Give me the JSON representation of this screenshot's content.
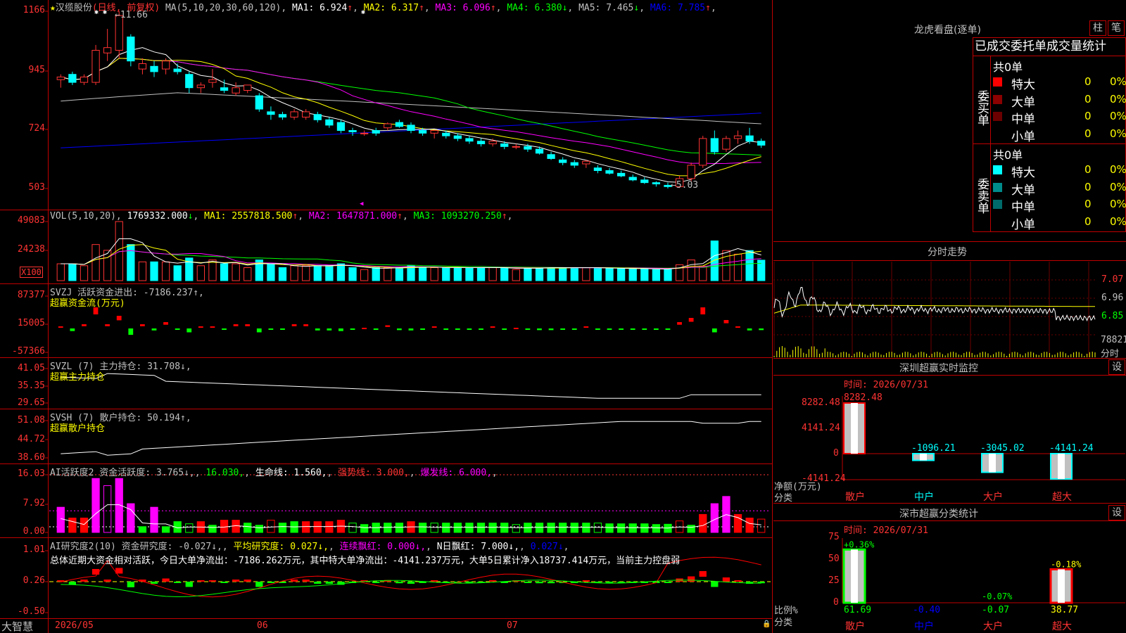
{
  "stock": {
    "name": "汉缆股份",
    "period": "(日线, 前复权)",
    "ma_readout": [
      {
        "label": "MA(5,10,20,30,60,120)",
        "color": "#c0c0c0"
      },
      {
        "label": "MA1: 6.924",
        "arrow": "↑",
        "color": "#ffffff"
      },
      {
        "label": "MA2: 6.317",
        "arrow": "↑",
        "color": "#ffff00"
      },
      {
        "label": "MA3: 6.096",
        "arrow": "↑",
        "color": "#ff00ff"
      },
      {
        "label": "MA4: 6.380",
        "arrow": "↓",
        "color": "#00ff00"
      },
      {
        "label": "MA5: 7.465",
        "arrow": "↓",
        "color": "#c0c0c0"
      },
      {
        "label": "MA6: 7.785",
        "arrow": "↑",
        "color": "#0000ff"
      }
    ],
    "high_label": "11.66",
    "low_label": "5.03"
  },
  "price_axis": [
    "1166",
    "945",
    "724",
    "503"
  ],
  "vol_readout": [
    {
      "label": "VOL(5,10,20)",
      "color": "#c0c0c0"
    },
    {
      "label": "1769332.000",
      "arrow": "↓",
      "color": "#ffffff"
    },
    {
      "label": "MA1: 2557818.500",
      "arrow": "↑",
      "color": "#ffff00"
    },
    {
      "label": "MA2: 1647871.000",
      "arrow": "↑",
      "color": "#ff00ff"
    },
    {
      "label": "MA3: 1093270.250",
      "arrow": "↑",
      "color": "#00ff00"
    }
  ],
  "vol_axis": [
    "49083",
    "24238"
  ],
  "vol_unit": "X100",
  "svzj": {
    "readout": "SVZJ  活跃资金进出: -7186.237↑,",
    "sub": "超赢资金流(万元)",
    "axis": [
      "87377",
      "15005",
      "-57366"
    ]
  },
  "svzl": {
    "readout": "SVZL (7) 主力持仓: 31.708↓,",
    "sub": "超赢主力持仓",
    "axis": [
      "41.05",
      "35.35",
      "29.65"
    ]
  },
  "svsh": {
    "readout": "SVSH (7) 散户持仓: 50.194↑,",
    "sub": "超赢散户持仓",
    "axis": [
      "51.08",
      "44.72",
      "38.60"
    ]
  },
  "ai1": {
    "readout": [
      {
        "label": "AI活跃度2 资金活跃度: 3.765↓,",
        "color": "#c0c0c0"
      },
      {
        "label": "16.030,",
        "color": "#00ff00"
      },
      {
        "label": "生命线: 1.560,",
        "color": "#ffffff"
      },
      {
        "label": "强势线: 3.000,",
        "color": "#ff3333"
      },
      {
        "label": "爆发线: 6.000,",
        "color": "#ff00ff"
      }
    ],
    "axis": [
      "16.03",
      "7.92",
      "0.00"
    ]
  },
  "ai2": {
    "readout": [
      {
        "label": "AI研究度2(10) 资金研究度: -0.027↓,",
        "color": "#c0c0c0"
      },
      {
        "label": "平均研究度: 0.027↓,",
        "color": "#ffff00"
      },
      {
        "label": "连续飘红: 0.000↓,",
        "color": "#ff00ff"
      },
      {
        "label": "N日飘红: 7.000↓,",
        "color": "#ffffff"
      },
      {
        "label": "0.027↓",
        "color": "#0000ff"
      }
    ],
    "summary": "总体近期大资金相对活跃，今日大单净流出：-7186.262万元，其中特大单净流出：-4141.237万元，大单5日累计净入18737.414万元，当前主力控盘弱",
    "axis": [
      "1.01",
      "0.26",
      "-0.50"
    ]
  },
  "time_axis": {
    "brand": "大智慧",
    "labels": [
      "2026/05",
      "06",
      "07"
    ]
  },
  "chart_data": [
    {
      "type": "candlestick",
      "title": "汉缆股份 (日线, 前复权)",
      "ylim": [
        5.03,
        11.66
      ],
      "series": [
        {
          "name": "K",
          "ohlc": [
            [
              9.1,
              9.3,
              8.8,
              9.2
            ],
            [
              9.3,
              9.4,
              8.9,
              9.0
            ],
            [
              9.0,
              9.3,
              8.9,
              9.2
            ],
            [
              9.0,
              10.4,
              8.9,
              10.2
            ],
            [
              10.1,
              11.0,
              9.8,
              10.3
            ],
            [
              10.2,
              11.66,
              9.9,
              11.5
            ],
            [
              10.7,
              10.8,
              9.6,
              9.8
            ],
            [
              9.5,
              9.9,
              9.3,
              9.7
            ],
            [
              9.6,
              9.8,
              9.2,
              9.4
            ],
            [
              9.5,
              9.9,
              9.3,
              9.8
            ],
            [
              9.5,
              9.7,
              9.3,
              9.4
            ],
            [
              9.3,
              9.4,
              8.6,
              8.8
            ],
            [
              8.8,
              9.0,
              8.6,
              8.9
            ],
            [
              9.0,
              9.5,
              8.8,
              9.1
            ],
            [
              8.8,
              9.1,
              8.6,
              8.7
            ],
            [
              8.6,
              9.0,
              8.5,
              8.8
            ],
            [
              8.7,
              8.9,
              8.6,
              8.9
            ],
            [
              8.5,
              8.6,
              7.9,
              8.0
            ],
            [
              7.9,
              8.1,
              7.6,
              7.8
            ],
            [
              7.8,
              7.9,
              7.6,
              7.7
            ],
            [
              7.7,
              8.0,
              7.6,
              7.9
            ],
            [
              7.7,
              8.0,
              7.6,
              7.9
            ],
            [
              7.8,
              7.9,
              7.5,
              7.6
            ],
            [
              7.6,
              7.7,
              7.3,
              7.4
            ],
            [
              7.5,
              7.6,
              7.1,
              7.2
            ],
            [
              7.2,
              7.3,
              7.0,
              7.15
            ],
            [
              7.1,
              7.2,
              7.0,
              7.1
            ],
            [
              7.2,
              7.3,
              7.0,
              7.1
            ],
            [
              7.3,
              7.5,
              7.2,
              7.45
            ],
            [
              7.5,
              7.6,
              7.3,
              7.35
            ],
            [
              7.4,
              7.5,
              7.1,
              7.2
            ],
            [
              7.2,
              7.3,
              7.0,
              7.1
            ],
            [
              7.1,
              7.2,
              6.9,
              7.2
            ],
            [
              7.1,
              7.2,
              6.9,
              7.0
            ],
            [
              7.0,
              7.1,
              6.8,
              6.9
            ],
            [
              6.9,
              7.0,
              6.7,
              6.8
            ],
            [
              6.8,
              6.9,
              6.6,
              6.7
            ],
            [
              6.7,
              6.9,
              6.6,
              6.8
            ],
            [
              6.7,
              6.8,
              6.5,
              6.6
            ],
            [
              6.6,
              6.7,
              6.5,
              6.6
            ],
            [
              6.6,
              6.7,
              6.4,
              6.5
            ],
            [
              6.5,
              6.6,
              6.3,
              6.35
            ],
            [
              6.3,
              6.4,
              6.1,
              6.15
            ],
            [
              6.1,
              6.2,
              5.9,
              6.0
            ],
            [
              6.0,
              6.1,
              5.8,
              5.9
            ],
            [
              5.95,
              6.1,
              5.8,
              6.05
            ],
            [
              5.8,
              5.9,
              5.6,
              5.7
            ],
            [
              5.7,
              5.8,
              5.55,
              5.6
            ],
            [
              5.6,
              5.7,
              5.45,
              5.5
            ],
            [
              5.45,
              5.55,
              5.3,
              5.35
            ],
            [
              5.35,
              5.45,
              5.2,
              5.25
            ],
            [
              5.25,
              5.3,
              5.1,
              5.2
            ],
            [
              5.15,
              5.25,
              5.03,
              5.1
            ],
            [
              5.1,
              5.5,
              5.05,
              5.4
            ],
            [
              5.4,
              6.0,
              5.3,
              5.9
            ],
            [
              5.9,
              7.0,
              5.8,
              6.9
            ],
            [
              6.9,
              7.2,
              6.3,
              6.4
            ],
            [
              6.5,
              7.0,
              6.4,
              6.9
            ],
            [
              6.9,
              7.2,
              6.7,
              7.0
            ],
            [
              7.0,
              7.3,
              6.7,
              6.8
            ],
            [
              6.8,
              6.9,
              6.55,
              6.65
            ]
          ]
        }
      ]
    }
  ],
  "sidebar": {
    "header_title": "龙虎看盘(逐单)",
    "btn_bar": "柱",
    "btn_pen": "笔",
    "subtitle": "已成交委托单成交量统计",
    "buy": {
      "side_label": "委买单",
      "total": "共0单",
      "rows": [
        {
          "label": "特大",
          "count": "0",
          "pct": "0%",
          "color": "#ff0000"
        },
        {
          "label": "大单",
          "count": "0",
          "pct": "0%",
          "color": "#8b0000"
        },
        {
          "label": "中单",
          "count": "0",
          "pct": "0%",
          "color": "#6b0000"
        },
        {
          "label": "小单",
          "count": "0",
          "pct": "0%",
          "color": ""
        }
      ]
    },
    "sell": {
      "side_label": "委卖单",
      "total": "共0单",
      "rows": [
        {
          "label": "特大",
          "count": "0",
          "pct": "0%",
          "color": "#00ffff"
        },
        {
          "label": "大单",
          "count": "0",
          "pct": "0%",
          "color": "#008b8b"
        },
        {
          "label": "中单",
          "count": "0",
          "pct": "0%",
          "color": "#006b6b"
        },
        {
          "label": "小单",
          "count": "0",
          "pct": "0%",
          "color": ""
        }
      ]
    },
    "intraday_title": "分时走势",
    "intraday_axis": [
      "7.07",
      "6.96",
      "6.85"
    ],
    "intraday_vol": "78821",
    "intraday_unit": "分时",
    "monitor": {
      "title": "深圳超赢实时监控",
      "settings": "设",
      "time": "时间: 2026/07/31",
      "axis": [
        "8282.48",
        "4141.24",
        "0",
        "-4141.24"
      ],
      "ylabel": "净额(万元)",
      "xlabel": "分类",
      "bars": [
        {
          "cat": "散户",
          "value": "8282.48"
        },
        {
          "cat": "中户",
          "value": "-1096.21"
        },
        {
          "cat": "大户",
          "value": "-3045.02"
        },
        {
          "cat": "超大",
          "value": "-4141.24"
        }
      ]
    },
    "classify": {
      "title": "深市超赢分类统计",
      "settings": "设",
      "time": "时间: 2026/07/31",
      "axis": [
        "75",
        "50",
        "25",
        "0"
      ],
      "ylabel": "比例%",
      "xlabel": "分类",
      "bars": [
        {
          "cat": "散户",
          "top": "+0.36%",
          "value": "61.69"
        },
        {
          "cat": "中户",
          "top": "",
          "value": "-0.40"
        },
        {
          "cat": "大户",
          "top": "-0.07%",
          "value": "-0.07"
        },
        {
          "cat": "超大",
          "top": "-0.18%",
          "value": "38.77"
        }
      ]
    }
  }
}
